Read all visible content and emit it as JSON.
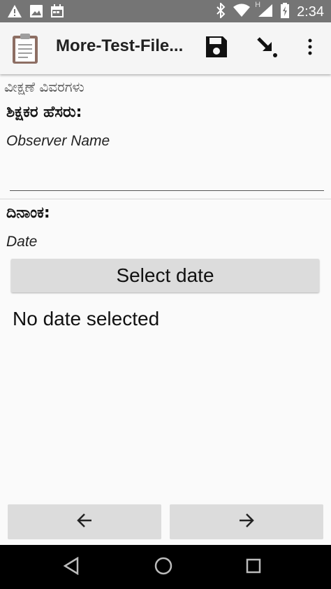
{
  "status_bar": {
    "time": "2:34",
    "left_icons": [
      "warning-icon",
      "image-icon",
      "calendar-icon"
    ],
    "right_icons": [
      "bluetooth-icon",
      "wifi-icon",
      "signal-icon",
      "battery-icon"
    ],
    "network_letter": "H"
  },
  "app_bar": {
    "title": "More-Test-File...",
    "actions": [
      "save-icon",
      "go-to-icon",
      "overflow-menu-icon"
    ]
  },
  "form": {
    "section_title": "ವೀಕ್ಷಣೆ ವಿವರಗಳು",
    "questions": [
      {
        "label": "ಶಿಕ್ಷಕರ ಹೆಸರು:",
        "hint": "Observer Name",
        "value": ""
      },
      {
        "label": "ದಿನಾಂಕ:",
        "hint": "Date"
      }
    ],
    "select_date_label": "Select date",
    "no_date_text": "No date selected"
  },
  "navigation": {
    "back_icon": "arrow-left-icon",
    "forward_icon": "arrow-right-icon"
  },
  "colors": {
    "status_bar": "#757575",
    "app_bar": "#f5f5f5",
    "button": "#dcdcdc",
    "system_nav": "#000000"
  }
}
